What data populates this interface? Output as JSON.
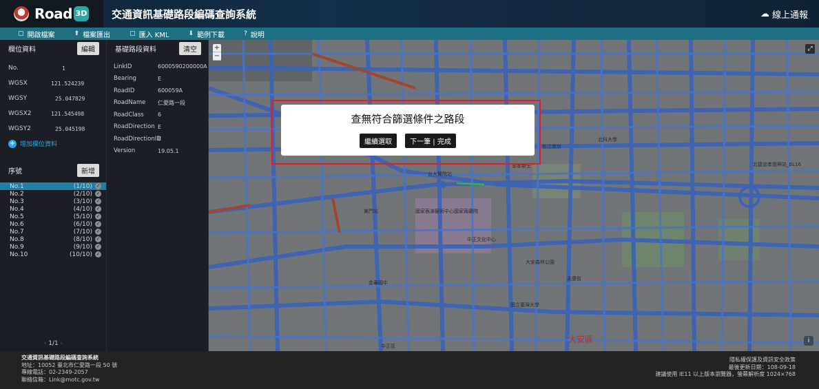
{
  "header": {
    "logo_text": "Road",
    "logo_badge": "3D",
    "logo_sub": "交通部",
    "title": "交通資訊基礎路段編碼查詢系統",
    "right_link": "線上通報",
    "right_icon": "cloud-icon"
  },
  "toolbar": {
    "items": [
      {
        "icon": "folder-icon",
        "label": "開啟檔案"
      },
      {
        "icon": "upload-icon",
        "label": "檔案匯出"
      },
      {
        "icon": "file-icon",
        "label": "匯入 KML"
      },
      {
        "icon": "download-icon",
        "label": "範例下載"
      },
      {
        "icon": "help-icon",
        "label": "說明"
      }
    ]
  },
  "field_panel": {
    "title": "欄位資料",
    "edit_button": "編輯",
    "fields": [
      {
        "key": "No.",
        "value": "1"
      },
      {
        "key": "WGSX",
        "value": "121.524239"
      },
      {
        "key": "WGSY",
        "value": "25.047829"
      },
      {
        "key": "WGSX2",
        "value": "121.545498"
      },
      {
        "key": "WGSY2",
        "value": "25.045198"
      }
    ],
    "add_field": "增加欄位資料"
  },
  "sequence_panel": {
    "title": "序號",
    "add_button": "新增",
    "items": [
      {
        "name": "No.1",
        "count": "(1/10)",
        "active": true
      },
      {
        "name": "No.2",
        "count": "(2/10)",
        "active": false
      },
      {
        "name": "No.3",
        "count": "(3/10)",
        "active": false
      },
      {
        "name": "No.4",
        "count": "(4/10)",
        "active": false
      },
      {
        "name": "No.5",
        "count": "(5/10)",
        "active": false
      },
      {
        "name": "No.6",
        "count": "(6/10)",
        "active": false
      },
      {
        "name": "No.7",
        "count": "(7/10)",
        "active": false
      },
      {
        "name": "No.8",
        "count": "(8/10)",
        "active": false
      },
      {
        "name": "No.9",
        "count": "(9/10)",
        "active": false
      },
      {
        "name": "No.10",
        "count": "(10/10)",
        "active": false
      }
    ],
    "pager": {
      "prev": "‹",
      "page": "1/1",
      "next": "›"
    }
  },
  "road_panel": {
    "title": "基礎路段資料",
    "clear_button": "清空",
    "fields": [
      {
        "key": "LinkID",
        "value": "6000590200000A"
      },
      {
        "key": "Bearing",
        "value": "E"
      },
      {
        "key": "RoadID",
        "value": "600059A"
      },
      {
        "key": "RoadName",
        "value": "仁愛路一段"
      },
      {
        "key": "RoadClass",
        "value": "6"
      },
      {
        "key": "RoadDirection",
        "value": "E"
      },
      {
        "key": "RoadDirectionID",
        "value": "E"
      },
      {
        "key": "Version",
        "value": "19.05.1"
      }
    ]
  },
  "map": {
    "zoom_in": "+",
    "zoom_out": "−",
    "district_label": "大安區",
    "labels": [
      "中正區",
      "國家表演藝術中心國家兩廳院",
      "中正文化中心",
      "台大醫院站",
      "東門站",
      "北科大學",
      "松江南京",
      "忠孝新生",
      "北捷忠孝復興站_BL16",
      "大安森林公園",
      "國立臺灣大學",
      "金華國中",
      "永康街"
    ]
  },
  "modal": {
    "message": "查無符合篩選條件之路段",
    "continue_button": "繼續選取",
    "next_button": "下一筆 | 完成"
  },
  "footer": {
    "org": "交通資訊基礎路段編碼查詢系統",
    "address": "地址：10052 臺北市仁愛路一段 50 號",
    "phone": "專線電話：02-2349-2057",
    "email": "聯絡信箱：Link@motc.gov.tw",
    "policy": "隱私權保護及資訊安全政策",
    "updated": "最後更新日期：108-09-18",
    "browser": "建議使用 IE11 以上版本瀏覽器，螢幕解析度 1024×768"
  }
}
